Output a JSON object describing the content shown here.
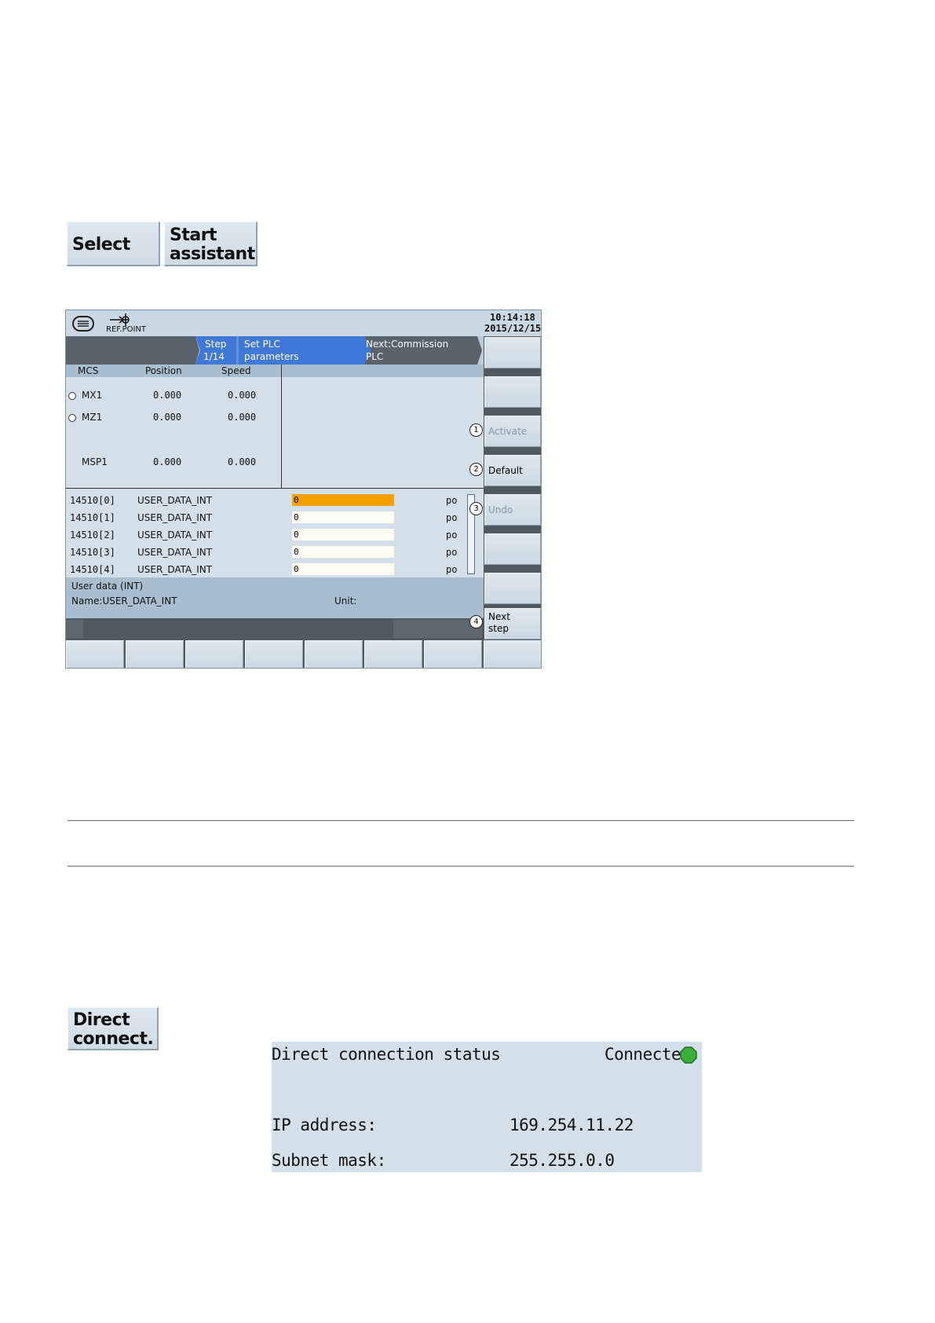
{
  "softkeys_top": {
    "select": "Select",
    "start_line1": "Start",
    "start_line2": "assistant"
  },
  "screen": {
    "refpoint_label": "REF.POINT",
    "time": "10:14:18",
    "date": "2015/12/15",
    "nav": {
      "step_label": "Step",
      "step_count": "1/14",
      "current_line1": "Set PLC",
      "current_line2": "parameters",
      "next_line1": "Next:Commission",
      "next_line2": "PLC"
    },
    "axes_header": {
      "mcs": "MCS",
      "position": "Position",
      "speed": "Speed"
    },
    "axes": [
      {
        "name": "MX1",
        "position": "0.000",
        "speed": "0.000"
      },
      {
        "name": "MZ1",
        "position": "0.000",
        "speed": "0.000"
      },
      {
        "name": "MSP1",
        "position": "0.000",
        "speed": "0.000"
      }
    ],
    "params": [
      {
        "id": "14510[0]",
        "name": "USER_DATA_INT",
        "value": "0",
        "unit": "po"
      },
      {
        "id": "14510[1]",
        "name": "USER_DATA_INT",
        "value": "0",
        "unit": "po"
      },
      {
        "id": "14510[2]",
        "name": "USER_DATA_INT",
        "value": "0",
        "unit": "po"
      },
      {
        "id": "14510[3]",
        "name": "USER_DATA_INT",
        "value": "0",
        "unit": "po"
      },
      {
        "id": "14510[4]",
        "name": "USER_DATA_INT",
        "value": "0",
        "unit": "po"
      }
    ],
    "info": {
      "desc": "User data (INT)",
      "name": "Name:USER_DATA_INT",
      "unit": "Unit:"
    },
    "vsoftkeys": {
      "activate": "Activate",
      "default": "Default",
      "undo": "Undo",
      "next_line1": "Next",
      "next_line2": "step"
    },
    "markers": [
      "1",
      "2",
      "3",
      "4"
    ]
  },
  "softkey_direct": {
    "line1": "Direct",
    "line2": "connect."
  },
  "direct_status": {
    "title": "Direct connection status",
    "state": "Connected",
    "ip_label": "IP address:",
    "ip_value": "169.254.11.22",
    "mask_label": "Subnet mask:",
    "mask_value": "255.255.0.0"
  },
  "colors": {
    "highlight": "#f5a000",
    "connected": "#3cae3c",
    "nav_active": "#3f78d6"
  }
}
